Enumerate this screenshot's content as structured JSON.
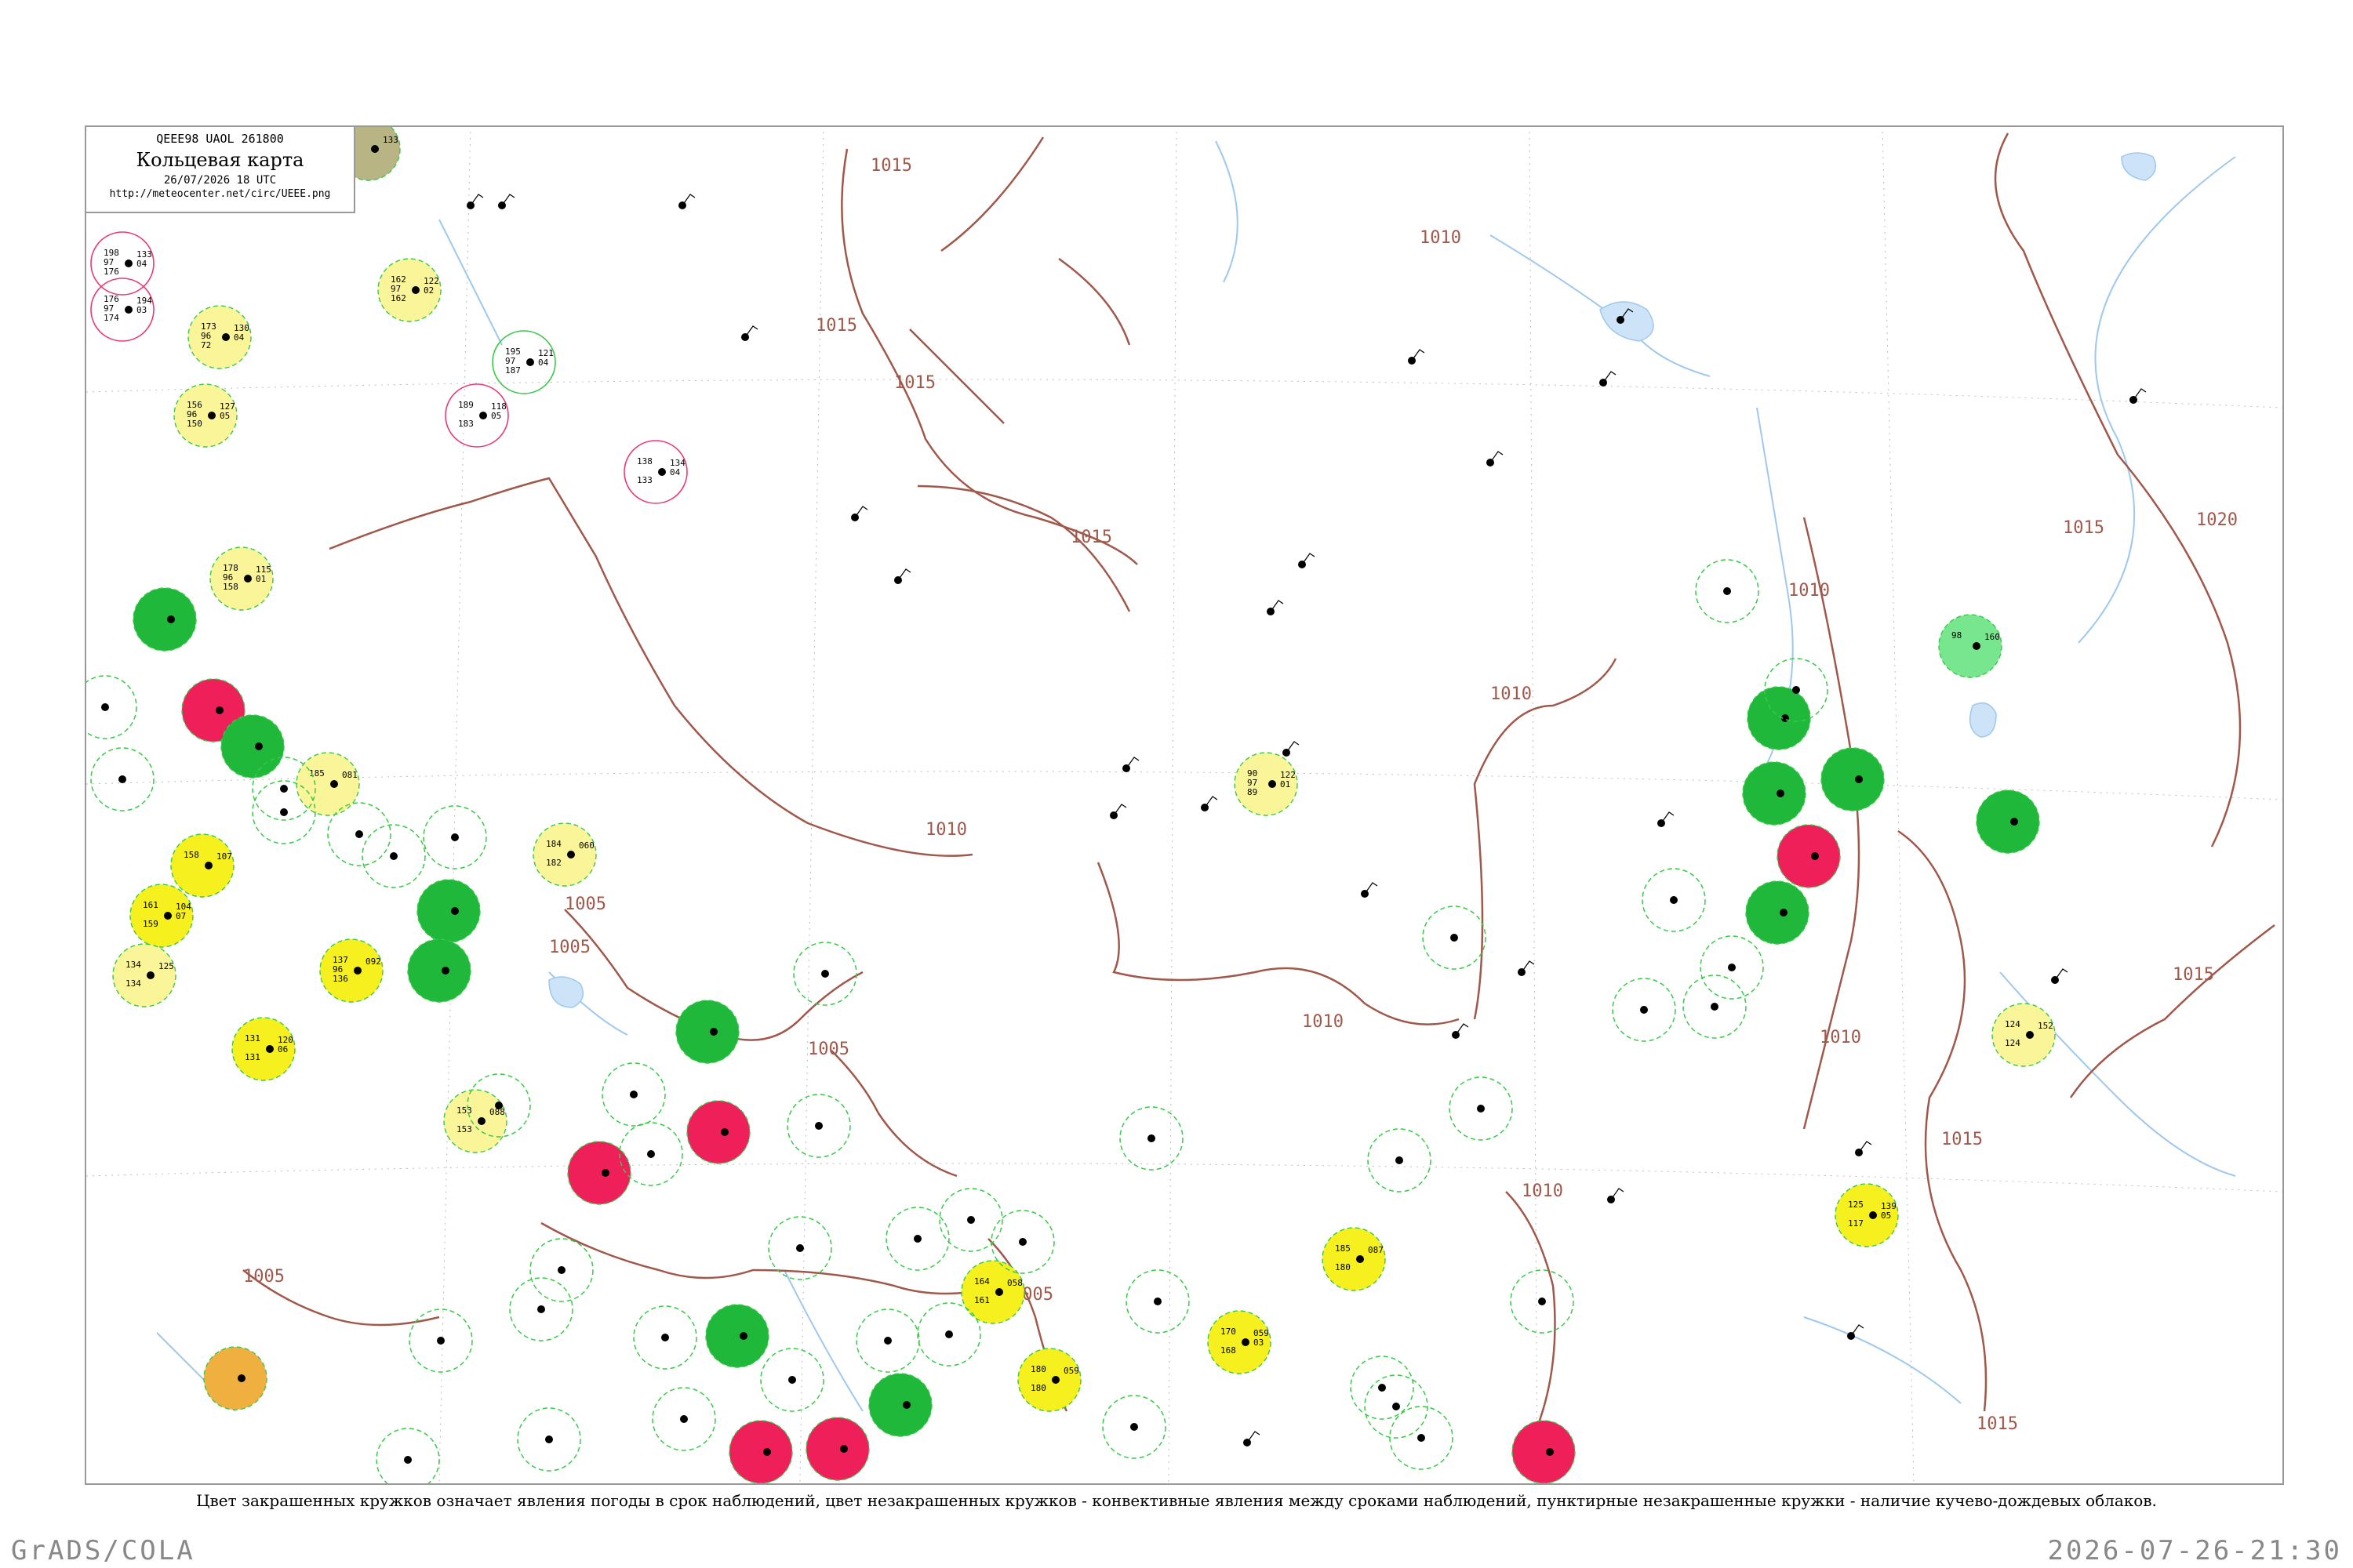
{
  "header": {
    "codes": "QEEE98  UAOL  261800",
    "title": "Кольцевая карта",
    "timestamp": "26/07/2026 18 UTC",
    "url": "http://meteocenter.net/circ/UEEE.png"
  },
  "caption": "Цвет закрашенных кружков означает явления погоды в срок наблюдений, цвет незакрашенных кружков - конвективные явления между сроками наблюдений, пунктирные незакрашенные кружки - наличие кучево-дождевых облаков.",
  "footer": {
    "left": "GrADS/COLA",
    "right": "2026-07-26-21:30"
  },
  "colors": {
    "isobar": "#a0584a",
    "river": "#9ec8ee",
    "green_fill": "#1fb83a",
    "yellow_fill": "#f5f01e",
    "pale_yellow_fill": "#fbf59a",
    "red_fill": "#ef1f5a",
    "orange_fill": "#f0b040",
    "light_green_fill": "#78e68e",
    "olive_fill": "#b8b484",
    "dashed_green": "#3cc84a",
    "ring_pink": "#e83a78"
  },
  "isobar_labels": [
    {
      "text": "1015"
    },
    {
      "text": "1015"
    },
    {
      "text": "1015"
    },
    {
      "text": "1015"
    },
    {
      "text": "1010"
    },
    {
      "text": "1010"
    },
    {
      "text": "1010"
    },
    {
      "text": "1010"
    },
    {
      "text": "1005"
    },
    {
      "text": "1005"
    },
    {
      "text": "1005"
    },
    {
      "text": "1005"
    },
    {
      "text": "1015"
    },
    {
      "text": "1020"
    },
    {
      "text": "1010"
    },
    {
      "text": "1010"
    },
    {
      "text": "1015"
    },
    {
      "text": "1015"
    },
    {
      "text": "1015"
    },
    {
      "text": "1010"
    },
    {
      "text": "1005"
    }
  ],
  "stations": [
    {
      "top": "198",
      "mid": "97",
      "bot": "176",
      "right": "133",
      "r2": "04",
      "name": "",
      "marker": "ring-pink"
    },
    {
      "top": "176",
      "mid": "97",
      "bot": "174",
      "right": "194",
      "r2": "03",
      "name": "",
      "marker": "ring-pink"
    },
    {
      "top": "173",
      "mid": "96",
      "bot": "72",
      "right": "130",
      "r2": "04",
      "name": "",
      "marker": "pale-yellow"
    },
    {
      "top": "156",
      "mid": "96",
      "bot": "150",
      "right": "127",
      "r2": "05",
      "name": "",
      "marker": "pale-yellow"
    },
    {
      "top": "162",
      "mid": "97",
      "bot": "162",
      "right": "122",
      "r2": "02",
      "name": "",
      "marker": "pale-yellow"
    },
    {
      "top": "195",
      "mid": "97",
      "bot": "187",
      "right": "121",
      "r2": "04",
      "name": "",
      "marker": "ring-green"
    },
    {
      "top": "189",
      "mid": "",
      "bot": "183",
      "right": "118",
      "r2": "05",
      "name": "",
      "marker": "ring-pink"
    },
    {
      "top": "138",
      "mid": "",
      "bot": "133",
      "right": "134",
      "r2": "04",
      "name": "",
      "marker": "ring-pink"
    },
    {
      "top": "178",
      "mid": "96",
      "bot": "158",
      "right": "115",
      "r2": "01",
      "name": "",
      "marker": "pale-yellow"
    },
    {
      "top": "",
      "mid": "",
      "bot": "",
      "right": "",
      "r2": "",
      "name": "",
      "marker": "green"
    },
    {
      "top": "",
      "mid": "",
      "bot": "",
      "right": "",
      "r2": "",
      "name": "",
      "marker": "red"
    },
    {
      "top": "",
      "mid": "",
      "bot": "",
      "right": "",
      "r2": "",
      "name": "",
      "marker": "green"
    },
    {
      "top": "185",
      "mid": "",
      "bot": "",
      "right": "081",
      "r2": "",
      "name": "",
      "marker": "pale-yellow"
    },
    {
      "top": "158",
      "mid": "",
      "bot": "",
      "right": "107",
      "r2": "",
      "name": "",
      "marker": "yellow"
    },
    {
      "top": "161",
      "mid": "",
      "bot": "159",
      "right": "104",
      "r2": "07",
      "name": "",
      "marker": "yellow"
    },
    {
      "top": "134",
      "mid": "",
      "bot": "134",
      "right": "125",
      "r2": "",
      "name": "",
      "marker": "pale-yellow"
    },
    {
      "top": "137",
      "mid": "96",
      "bot": "136",
      "right": "092",
      "r2": "",
      "name": "",
      "marker": "yellow"
    },
    {
      "top": "131",
      "mid": "",
      "bot": "131",
      "right": "120",
      "r2": "06",
      "name": "",
      "marker": "yellow"
    },
    {
      "top": "",
      "mid": "",
      "bot": "",
      "right": "",
      "r2": "",
      "name": "",
      "marker": "green"
    },
    {
      "top": "",
      "mid": "",
      "bot": "",
      "right": "",
      "r2": "",
      "name": "",
      "marker": "green"
    },
    {
      "top": "184",
      "mid": "",
      "bot": "182",
      "right": "060",
      "r2": "",
      "name": "",
      "marker": "pale-yellow"
    },
    {
      "top": "153",
      "mid": "",
      "bot": "153",
      "right": "088",
      "r2": "",
      "name": "",
      "marker": "pale-yellow"
    },
    {
      "top": "",
      "mid": "",
      "bot": "",
      "right": "",
      "r2": "",
      "name": "",
      "marker": "green"
    },
    {
      "top": "",
      "mid": "",
      "bot": "",
      "right": "",
      "r2": "",
      "name": "",
      "marker": "red"
    },
    {
      "top": "",
      "mid": "",
      "bot": "",
      "right": "",
      "r2": "",
      "name": "",
      "marker": "red"
    },
    {
      "top": "",
      "mid": "",
      "bot": "",
      "right": "",
      "r2": "",
      "name": "",
      "marker": "orange"
    },
    {
      "top": "",
      "mid": "",
      "bot": "",
      "right": "",
      "r2": "",
      "name": "",
      "marker": "green"
    },
    {
      "top": "",
      "mid": "",
      "bot": "",
      "right": "",
      "r2": "",
      "name": "",
      "marker": "green"
    },
    {
      "top": "",
      "mid": "",
      "bot": "",
      "right": "",
      "r2": "",
      "name": "",
      "marker": "red"
    },
    {
      "top": "",
      "mid": "",
      "bot": "",
      "right": "",
      "r2": "",
      "name": "",
      "marker": "red"
    },
    {
      "top": "164",
      "mid": "",
      "bot": "161",
      "right": "058",
      "r2": "",
      "name": "",
      "marker": "yellow"
    },
    {
      "top": "180",
      "mid": "",
      "bot": "180",
      "right": "059",
      "r2": "",
      "name": "",
      "marker": "yellow"
    },
    {
      "top": "170",
      "mid": "",
      "bot": "168",
      "right": "059",
      "r2": "03",
      "name": "",
      "marker": "yellow"
    },
    {
      "top": "185",
      "mid": "",
      "bot": "180",
      "right": "087",
      "r2": "",
      "name": "",
      "marker": "yellow"
    },
    {
      "top": "90",
      "mid": "97",
      "bot": "89",
      "right": "122",
      "r2": "01",
      "name": "",
      "marker": "pale-yellow"
    },
    {
      "top": "",
      "mid": "",
      "bot": "",
      "right": "",
      "r2": "",
      "name": "",
      "marker": "green"
    },
    {
      "top": "",
      "mid": "",
      "bot": "",
      "right": "",
      "r2": "",
      "name": "",
      "marker": "green"
    },
    {
      "top": "",
      "mid": "",
      "bot": "",
      "right": "",
      "r2": "",
      "name": "",
      "marker": "red"
    },
    {
      "top": "",
      "mid": "",
      "bot": "",
      "right": "",
      "r2": "",
      "name": "",
      "marker": "green"
    },
    {
      "top": "",
      "mid": "",
      "bot": "",
      "right": "",
      "r2": "",
      "name": "",
      "marker": "green"
    },
    {
      "top": "",
      "mid": "",
      "bot": "",
      "right": "",
      "r2": "",
      "name": "",
      "marker": "green"
    },
    {
      "top": "98",
      "mid": "",
      "bot": "",
      "right": "160",
      "r2": "",
      "name": "",
      "marker": "light-green"
    },
    {
      "top": "124",
      "mid": "",
      "bot": "124",
      "right": "152",
      "r2": "",
      "name": "",
      "marker": "pale-yellow"
    },
    {
      "top": "125",
      "mid": "",
      "bot": "117",
      "right": "139",
      "r2": "05",
      "name": "",
      "marker": "yellow"
    },
    {
      "top": "",
      "mid": "",
      "bot": "",
      "right": "",
      "r2": "",
      "name": "",
      "marker": "red"
    },
    {
      "top": "",
      "mid": "",
      "bot": "",
      "right": "133",
      "r2": "",
      "name": "",
      "marker": "olive"
    }
  ]
}
